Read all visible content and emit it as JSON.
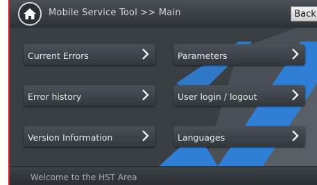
{
  "header": {
    "title": "Mobile Service Tool >> Main",
    "back_label": "Back",
    "home_icon": "home-icon"
  },
  "menu": {
    "items": [
      {
        "label": "Current Errors"
      },
      {
        "label": "Parameters"
      },
      {
        "label": "Error history"
      },
      {
        "label": "User login / logout"
      },
      {
        "label": "Version Information"
      },
      {
        "label": "Languages"
      }
    ],
    "chevron_icon": "chevron-right-icon"
  },
  "footer": {
    "status": "Welcome to the HST Area"
  },
  "colors": {
    "accent_blue": "#2f7fd6",
    "panel": "#3a3f44",
    "frame_red": "#c8232b"
  }
}
